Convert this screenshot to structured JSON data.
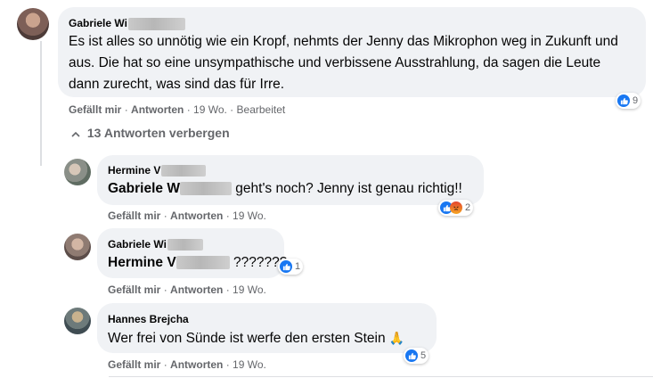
{
  "main_comment": {
    "author": "Gabriele Wi",
    "text": "Es ist alles so unnötig wie ein Kropf, nehmts der Jenny das Mikrophon weg in Zukunft und aus. Die hat so eine unsympathische und verbissene Ausstrahlung, da sagen die Leute dann zurecht, was sind das für Irre.",
    "like_label": "Gefällt mir",
    "reply_label": "Antworten",
    "time": "19 Wo.",
    "edited": "Bearbeitet",
    "reactions_count": "9",
    "reactions": [
      "like-icon"
    ]
  },
  "replies_toggle": {
    "arrow": "^",
    "label": "13 Antworten verbergen"
  },
  "replies": [
    {
      "author": "Hermine V",
      "mention": "Gabriele W",
      "text": "geht's noch? Jenny ist genau richtig!!",
      "like_label": "Gefällt mir",
      "reply_label": "Antworten",
      "time": "19 Wo.",
      "reactions_count": "2",
      "reactions": [
        "like-icon",
        "angry-icon"
      ]
    },
    {
      "author": "Gabriele Wi",
      "mention": "Hermine V",
      "text": "???????",
      "like_label": "Gefällt mir",
      "reply_label": "Antworten",
      "time": "19 Wo.",
      "reactions_count": "1",
      "reactions": [
        "like-icon"
      ]
    },
    {
      "author": "Hannes Brejcha",
      "text": "Wer frei von Sünde ist werfe den ersten Stein",
      "emoji": "🙏",
      "like_label": "Gefällt mir",
      "reply_label": "Antworten",
      "time": "19 Wo.",
      "reactions_count": "5",
      "reactions": [
        "like-icon"
      ]
    }
  ],
  "colors": {
    "bubble": "#f0f2f5",
    "meta_text": "#65676b",
    "like_blue": "#1877f2",
    "angry": "#e3442e"
  }
}
